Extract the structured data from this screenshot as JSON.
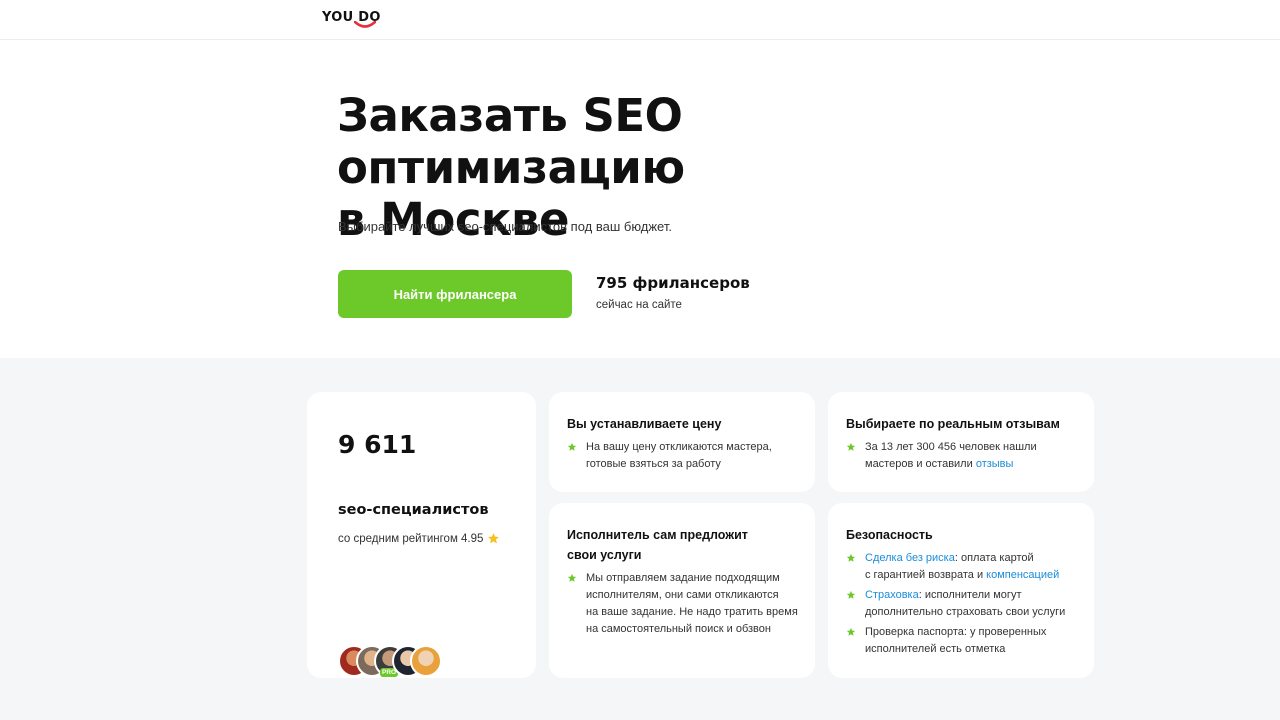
{
  "header": {
    "logo_text": "YOU DO"
  },
  "hero": {
    "title_line1": "Заказать SEO оптимизацию",
    "title_line2": "в Москве",
    "subtitle": "Выбирайте лучших seo-специалистов под ваш бюджет.",
    "cta_label": "Найти фрилансера",
    "freelancer_count": "795 фрилансеров",
    "freelancer_count_sub": "сейчас на сайте"
  },
  "stats": {
    "number": "9 611",
    "label": "seo-специалистов",
    "rating_text": "со средним рейтингом 4.95",
    "pro_badge": "PRO"
  },
  "features": {
    "price": {
      "title": "Вы устанавливаете цену",
      "bullet1_line1": "На вашу цену откликаются мастера,",
      "bullet1_line2": "готовые взяться за работу"
    },
    "reviews": {
      "title": "Выбираете по реальным отзывам",
      "bullet1_line1": "За 13 лет 300 456 человек нашли",
      "bullet1_line2": "мастеров и оставили ",
      "bullet1_link": "отзывы"
    },
    "offer": {
      "title_line1": "Исполнитель сам предложит",
      "title_line2": "свои услуги",
      "bullet1_line1": "Мы отправляем задание подходящим",
      "bullet1_line2": "исполнителям, они сами откликаются",
      "bullet1_line3": "на ваше задание. Не надо тратить время",
      "bullet1_line4": "на самостоятельный поиск и обзвон"
    },
    "safety": {
      "title": "Безопасность",
      "b1_link": "Сделка без риска",
      "b1_rest": ": оплата картой",
      "b1_line2": "с гарантией возврата и ",
      "b1_link2": "компенсацией",
      "b2_link": "Страховка",
      "b2_rest": ": исполнители могут",
      "b2_line2": "дополнительно страховать свои услуги",
      "b3_line1": "Проверка паспорта: у проверенных",
      "b3_line2": "исполнителей есть отметка"
    }
  },
  "colors": {
    "accent_green": "#6dc82a",
    "link_blue": "#1a8cd8",
    "logo_red": "#e8313c",
    "star_yellow": "#f5c022",
    "background_gray": "#f5f6f7"
  }
}
